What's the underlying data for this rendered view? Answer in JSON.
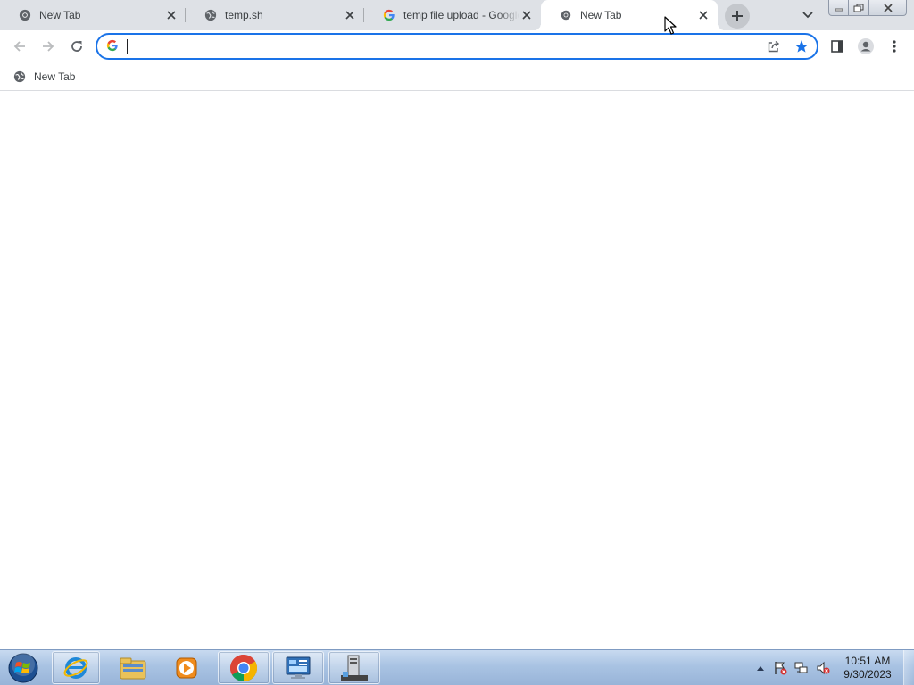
{
  "tabs": [
    {
      "title": "New Tab",
      "icon": "chrome-icon",
      "active": false
    },
    {
      "title": "temp.sh",
      "icon": "globe-icon",
      "active": false
    },
    {
      "title": "temp file upload - Google Search",
      "icon": "google-g-icon",
      "active": false
    },
    {
      "title": "New Tab",
      "icon": "chrome-icon",
      "active": true
    }
  ],
  "omnibox": {
    "value": "",
    "placeholder": "",
    "bookmarked": true
  },
  "bookmarks": [
    {
      "label": "New Tab",
      "icon": "globe-icon"
    }
  ],
  "taskbar": {
    "pinned": [
      "internet-explorer",
      "windows-explorer",
      "media-player",
      "chrome",
      "control-panel",
      "server-manager"
    ],
    "clock_time": "10:51 AM",
    "clock_date": "9/30/2023"
  },
  "colors": {
    "accent": "#1a73e8",
    "tabstrip": "#dee1e6",
    "taskbar": "#a9c3e3"
  }
}
